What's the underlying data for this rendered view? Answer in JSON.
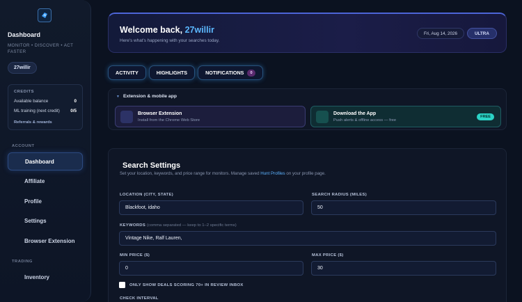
{
  "sidebar": {
    "title": "Dashboard",
    "subtitle": "MONITOR • DISCOVER • ACT FASTER",
    "username": "27willir",
    "credits": {
      "heading": "CREDITS",
      "rows": [
        {
          "label": "Available balance",
          "value": "0"
        },
        {
          "label": "ML training (next credit)",
          "value": "0/5"
        }
      ],
      "link": "Referrals & rewards"
    },
    "sections": [
      {
        "label": "ACCOUNT",
        "items": [
          "Dashboard",
          "Affiliate",
          "Profile",
          "Settings",
          "Browser Extension"
        ]
      },
      {
        "label": "TRADING",
        "items": [
          "Inventory"
        ]
      }
    ],
    "active_item": "Dashboard"
  },
  "header": {
    "welcome_prefix": "Welcome back, ",
    "username": "27willir",
    "subtitle": "Here's what's happening with your searches today.",
    "date": "Fri, Aug 14, 2026",
    "tier": "ULTRA"
  },
  "tabs": [
    {
      "label": "ACTIVITY"
    },
    {
      "label": "HIGHLIGHTS"
    },
    {
      "label": "NOTIFICATIONS",
      "badge": "0"
    }
  ],
  "extension": {
    "heading": "Extension & mobile app",
    "cards": [
      {
        "title": "Browser Extension",
        "subtitle": "Install from the Chrome Web Store"
      },
      {
        "title": "Download the App",
        "subtitle": "Push alerts & offline access — free",
        "badge": "FREE"
      }
    ]
  },
  "settings": {
    "title": "Search Settings",
    "desc_prefix": "Set your location, keywords, and price range for monitors. Manage saved ",
    "desc_link": "Hunt Profiles",
    "desc_suffix": " on your profile page.",
    "location_label": "LOCATION (CITY, STATE)",
    "location_value": "Blackfoot, idaho",
    "radius_label": "SEARCH RADIUS (MILES)",
    "radius_value": "50",
    "keywords_label": "KEYWORDS",
    "keywords_hint": "(comma separated — keep to 1–2 specific terms)",
    "keywords_value": "Vintage Nike, Ralf Lauren,",
    "min_label": "MIN PRICE ($)",
    "min_value": "0",
    "max_label": "MAX PRICE ($)",
    "max_value": "30",
    "checkbox_label": "ONLY SHOW DEALS SCORING 70+ IN REVIEW INBOX",
    "interval_label": "CHECK INTERVAL"
  },
  "colors": {
    "accent": "#5cb8ff",
    "background": "#0b1220",
    "free_badge": "#2bd3c6"
  }
}
